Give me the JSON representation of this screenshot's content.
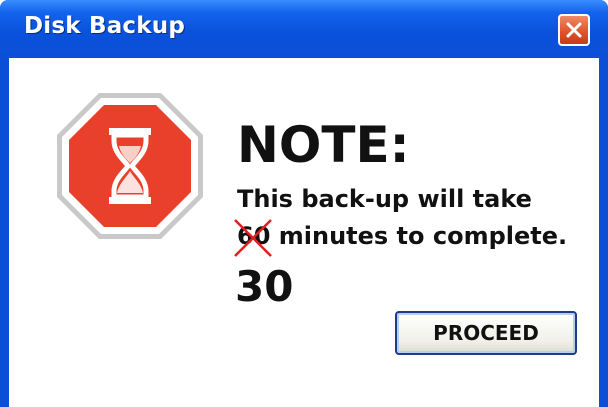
{
  "window": {
    "title": "Disk Backup"
  },
  "dialog": {
    "icon": "stop-hourglass-icon",
    "heading": "NOTE:",
    "line1": "This back-up will take",
    "old_minutes": "60",
    "line2_rest": " minutes to complete.",
    "new_minutes": "30",
    "proceed_label": "PROCEED"
  },
  "colors": {
    "titlebar": "#0a4fd6",
    "stop_sign": "#e8402a",
    "close_button": "#e0552e",
    "strike": "#e02020"
  }
}
